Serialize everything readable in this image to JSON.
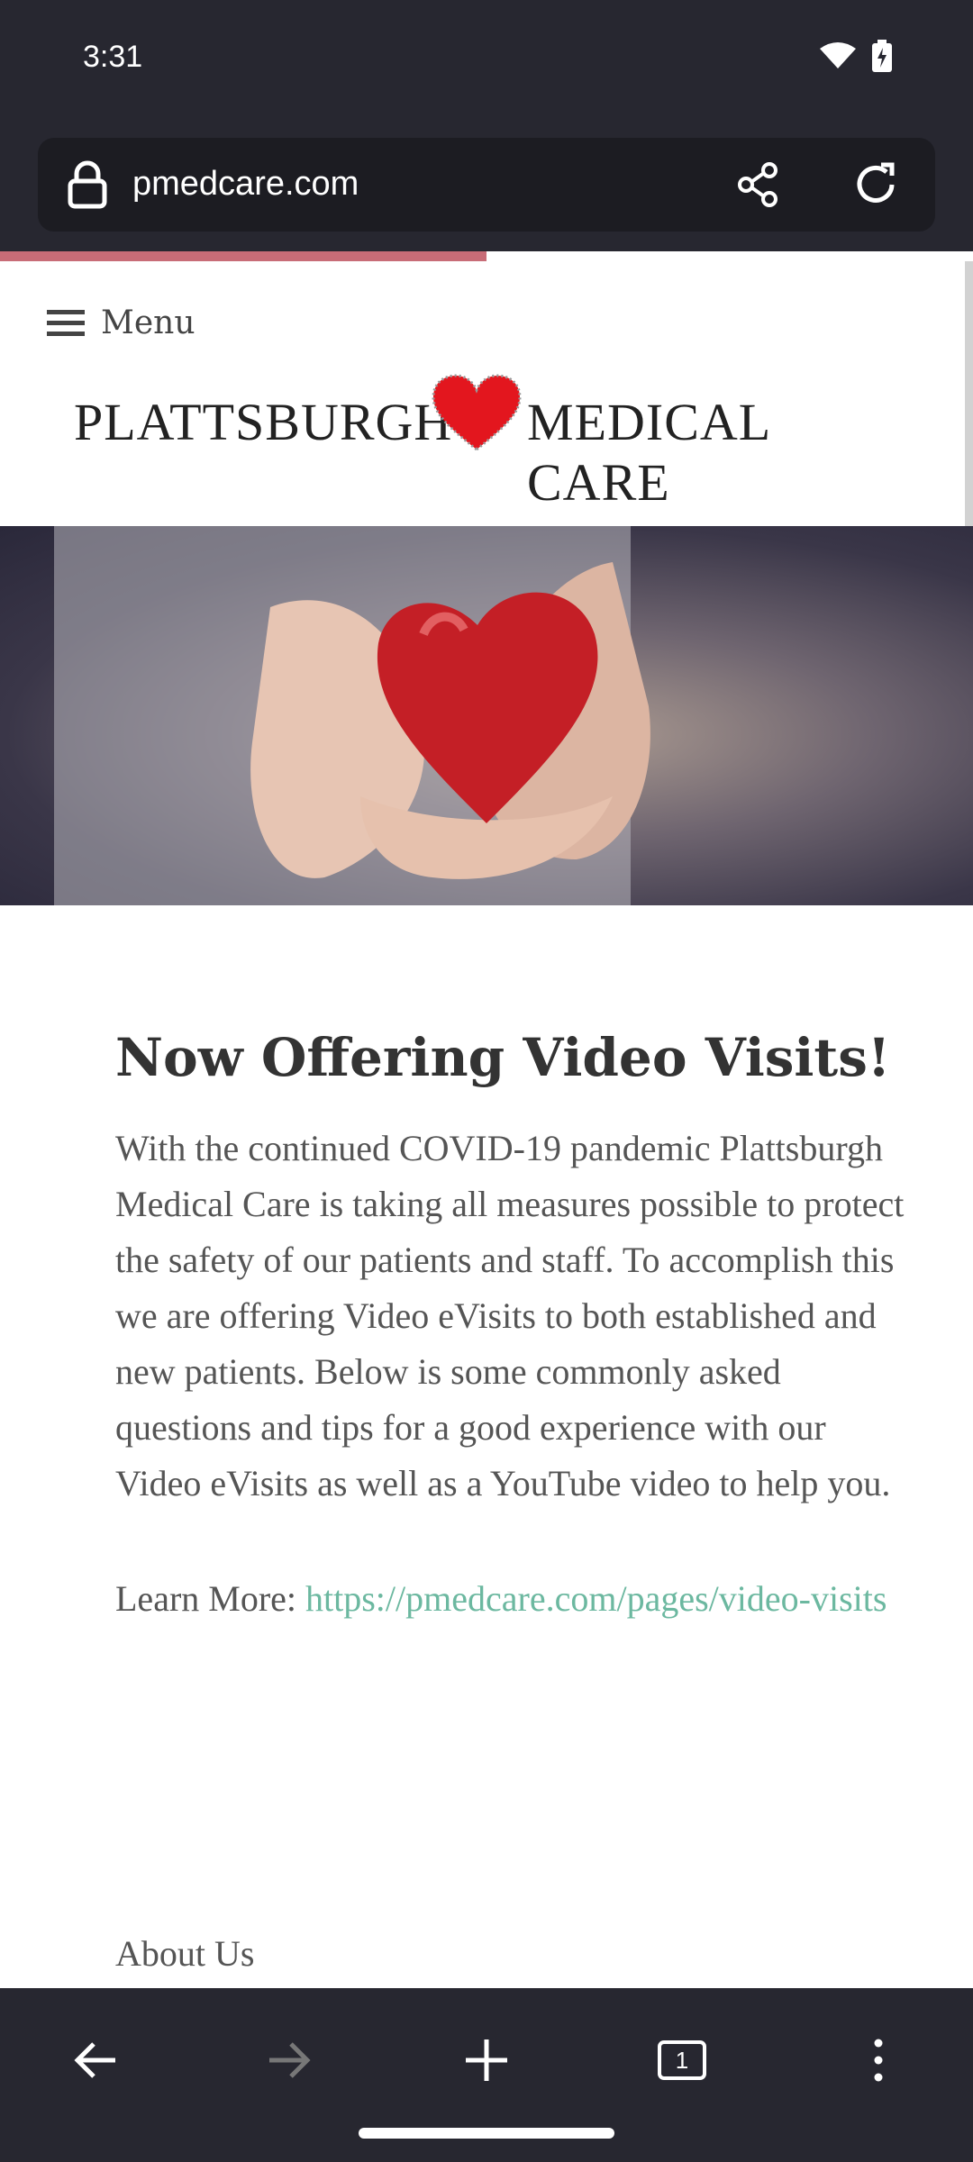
{
  "status_bar": {
    "time": "3:31"
  },
  "browser": {
    "url": "pmedcare.com",
    "load_progress": 0.5
  },
  "site": {
    "menu_label": "Menu",
    "logo_left": "PLATTSBURGH",
    "logo_right": "MEDICAL CARE",
    "headline": "Now Offering Video Visits!",
    "paragraph": "With the continued COVID-19 pandemic Plattsburgh Medical Care is taking all measures possible to protect the safety of our patients and staff. To accomplish this we are offering Video eVisits to both established and new patients. Below is some commonly asked questions and tips for a good experience with our Video eVisits as well as a YouTube video to help you.",
    "learn_more_label": "Learn More: ",
    "learn_more_link": "https://pmedcare.com/pages/video-visits",
    "about_label": "About Us"
  },
  "colors": {
    "link": "#6cb8a0",
    "progress": "#c86c77",
    "heart": "#e3161e",
    "chrome": "#272730"
  },
  "icons": {
    "lock": "lock-icon",
    "share": "share-icon",
    "reload": "reload-icon",
    "back": "back-arrow-icon",
    "forward": "forward-arrow-icon",
    "new_tab": "plus-icon",
    "tabs": "tab-switcher-icon",
    "more": "more-vert-icon"
  },
  "tab_count": "1"
}
